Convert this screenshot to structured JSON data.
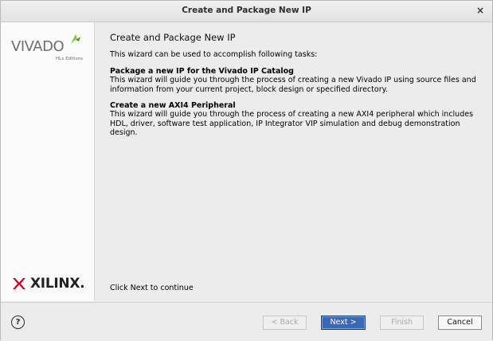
{
  "window": {
    "title": "Create and Package New IP",
    "close_glyph": "×"
  },
  "sidebar": {
    "vivado_logo": "VIVADO",
    "vivado_edition": "HLx Editions",
    "xilinx_logo": "XILINX."
  },
  "content": {
    "heading": "Create and Package New IP",
    "intro": "This wizard can be used to accomplish following tasks:",
    "sections": [
      {
        "title": "Package a new IP for the Vivado IP Catalog",
        "body": "This wizard will guide you through the process of creating a new Vivado IP using source files and information from your current project, block design or specified directory."
      },
      {
        "title": "Create a new AXI4 Peripheral",
        "body": "This wizard will guide you through the process of creating a new AXI4 peripheral which includes HDL, driver, software test application, IP Integrator VIP simulation and debug demonstration design."
      }
    ],
    "continue_text": "Click Next to continue"
  },
  "footer": {
    "help_glyph": "?",
    "back_label": "< Back",
    "next_label": "Next >",
    "finish_label": "Finish",
    "cancel_label": "Cancel"
  },
  "colors": {
    "primary_button": "#3a67b6",
    "vivado_leaf_green": "#8cc63f",
    "xilinx_red": "#c8102e"
  }
}
